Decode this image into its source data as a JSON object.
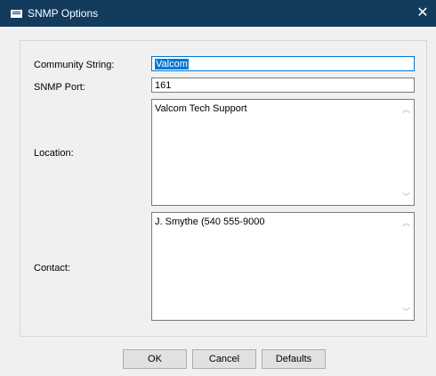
{
  "window": {
    "title": "SNMP Options",
    "icon": "window-icon",
    "close_glyph": "✕"
  },
  "form": {
    "community_label": "Community String:",
    "community_value": "Valcom",
    "port_label": "SNMP Port:",
    "port_value": "161",
    "location_label": "Location:",
    "location_value": "Valcom Tech Support",
    "contact_label": "Contact:",
    "contact_value": "J. Smythe (540 555-9000"
  },
  "buttons": {
    "ok": "OK",
    "cancel": "Cancel",
    "defaults": "Defaults"
  },
  "colors": {
    "titlebar": "#123b5e",
    "selection": "#0078d7"
  }
}
